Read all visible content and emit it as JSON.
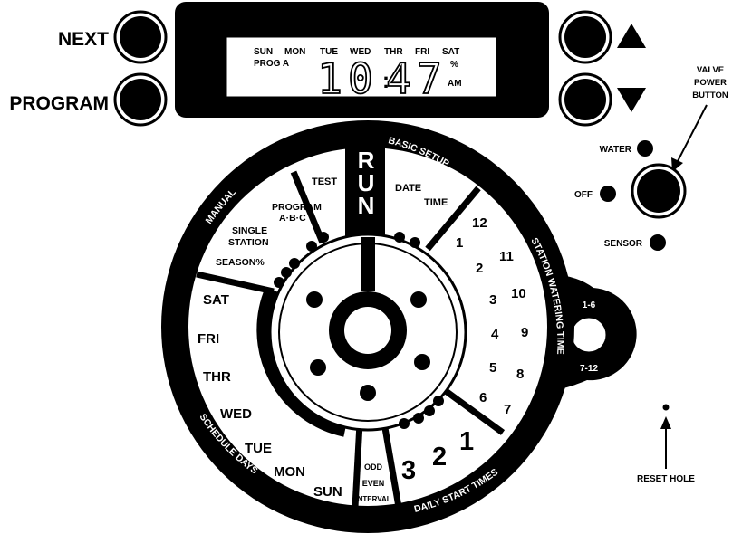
{
  "buttons": {
    "next": "NEXT",
    "program": "PROGRAM",
    "up_symbol": "▲",
    "down_symbol": "▼"
  },
  "display": {
    "days": [
      "SUN",
      "MON",
      "TUE",
      "WED",
      "THR",
      "FRI",
      "SAT"
    ],
    "prog": "PROG A",
    "time_hour": "10",
    "time_min": "47",
    "colon": ":",
    "percent": "%",
    "ampm": "AM"
  },
  "valve": {
    "label_lines": [
      "VALVE",
      "POWER",
      "BUTTON"
    ],
    "water": "WATER",
    "off": "OFF",
    "sensor": "SENSOR"
  },
  "dial": {
    "run": [
      "R",
      "U",
      "N"
    ],
    "basic_setup": "BASIC SETUP",
    "date": "DATE",
    "time": "TIME",
    "test": "TEST",
    "program": "PROGRAM",
    "program_abc": "A·B·C",
    "single": "SINGLE",
    "station": "STATION",
    "season": "SEASON%",
    "manual": "MANUAL",
    "station_watering_time": "STATION WATERING TIME",
    "schedule_days": "SCHEDULE DAYS",
    "daily_start_times": "DAILY START TIMES",
    "days": [
      "SAT",
      "FRI",
      "THR",
      "WED",
      "TUE",
      "MON",
      "SUN"
    ],
    "stations": [
      "1",
      "2",
      "3",
      "4",
      "5",
      "6",
      "7",
      "8",
      "9",
      "10",
      "11",
      "12"
    ],
    "start_times": [
      "1",
      "2",
      "3"
    ],
    "odd": "ODD",
    "even": "EVEN",
    "interval": "INTERVAL"
  },
  "side_switch": {
    "top": "1-6",
    "bottom": "7-12"
  },
  "reset": {
    "label": "RESET HOLE"
  }
}
